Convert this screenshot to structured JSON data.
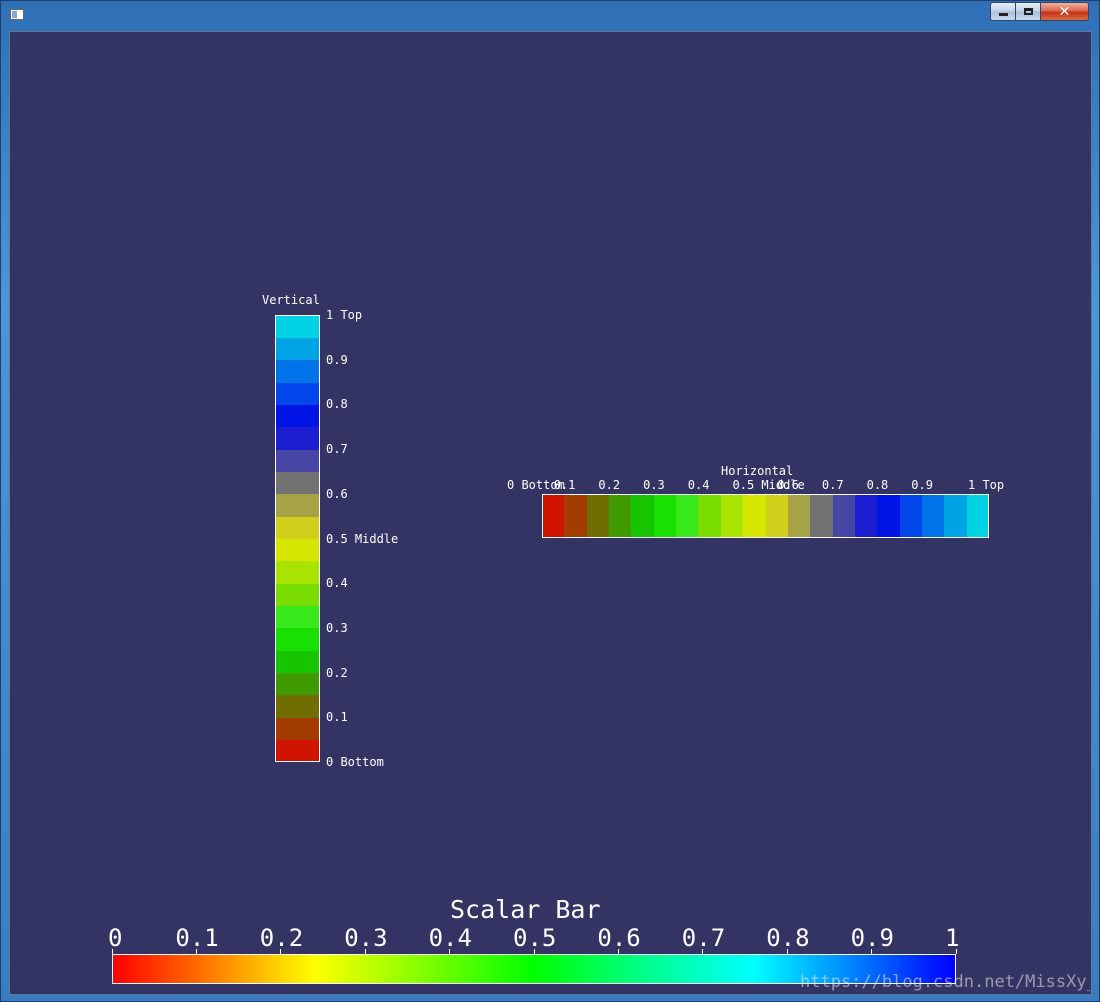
{
  "window": {
    "buttons": {
      "minimize_icon": "minimize-icon",
      "maximize_icon": "maximize-icon",
      "close_label": "✕"
    }
  },
  "vertical_bar": {
    "title": "Vertical",
    "colors": [
      "#d01400",
      "#a23c00",
      "#706e00",
      "#3f9a00",
      "#17c400",
      "#18e000",
      "#38e91c",
      "#7add00",
      "#a8e400",
      "#d6e600",
      "#d1cf1b",
      "#a6a347",
      "#727272",
      "#4646a4",
      "#1c1cd0",
      "#0014e6",
      "#0046ea",
      "#0073e8",
      "#00a3e4",
      "#00d3e4"
    ],
    "labels": [
      {
        "text": "1 Top",
        "value": 1.0
      },
      {
        "text": "0.9",
        "value": 0.9
      },
      {
        "text": "0.8",
        "value": 0.8
      },
      {
        "text": "0.7",
        "value": 0.7
      },
      {
        "text": "0.6",
        "value": 0.6
      },
      {
        "text": "0.5 Middle",
        "value": 0.5
      },
      {
        "text": "0.4",
        "value": 0.4
      },
      {
        "text": "0.3",
        "value": 0.3
      },
      {
        "text": "0.2",
        "value": 0.2
      },
      {
        "text": "0.1",
        "value": 0.1
      },
      {
        "text": "0 Bottom",
        "value": 0.0
      }
    ]
  },
  "horizontal_bar": {
    "title": "Horizontal",
    "colors": [
      "#d01400",
      "#a23c00",
      "#706e00",
      "#3f9a00",
      "#17c400",
      "#18e000",
      "#38e91c",
      "#7add00",
      "#a8e400",
      "#d6e600",
      "#d1cf1b",
      "#a6a347",
      "#727272",
      "#4646a4",
      "#1c1cd0",
      "#0014e6",
      "#0046ea",
      "#0073e8",
      "#00a3e4",
      "#00d3e4"
    ],
    "labels": [
      {
        "text": "0 Bottom",
        "value": 0.0
      },
      {
        "text": "0.1",
        "value": 0.1
      },
      {
        "text": "0.2",
        "value": 0.2
      },
      {
        "text": "0.3",
        "value": 0.3
      },
      {
        "text": "0.4",
        "value": 0.4
      },
      {
        "text": "0.5 Middle",
        "value": 0.5
      },
      {
        "text": "0.6",
        "value": 0.6
      },
      {
        "text": "0.7",
        "value": 0.7
      },
      {
        "text": "0.8",
        "value": 0.8
      },
      {
        "text": "0.9",
        "value": 0.9
      },
      {
        "text": "1 Top",
        "value": 1.0
      }
    ]
  },
  "scalar_bar": {
    "title": "Scalar Bar",
    "labels": [
      "0",
      "0.1",
      "0.2",
      "0.3",
      "0.4",
      "0.5",
      "0.6",
      "0.7",
      "0.8",
      "0.9",
      "1"
    ],
    "gradient": [
      "#ff0000",
      "#ffff00",
      "#00ff00",
      "#00ffff",
      "#0000ff"
    ]
  },
  "watermark": "https://blog.csdn.net/MissXy_"
}
